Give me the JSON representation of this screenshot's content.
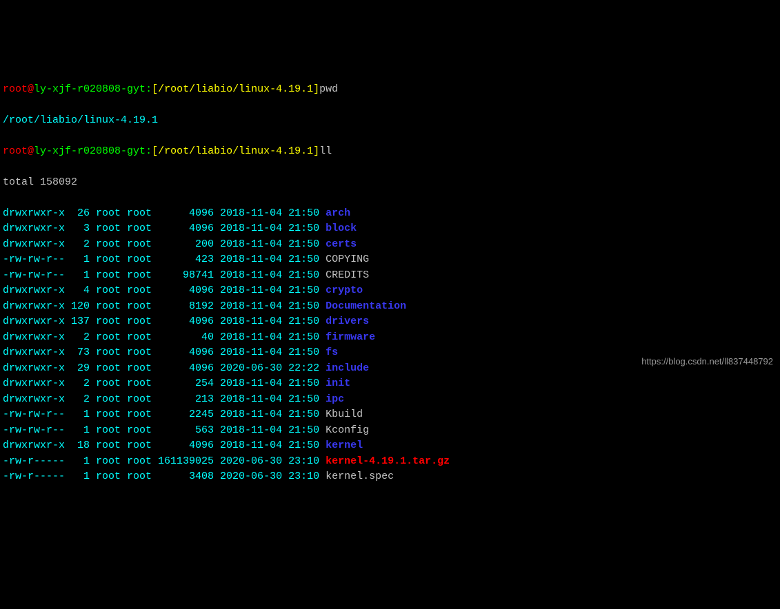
{
  "prompt1": {
    "user": "root",
    "at": "@",
    "host": "ly-xjf-r020808-gyt",
    "colon": ":",
    "lbracket": "[",
    "path": "/root/liabio/linux-4.19.1",
    "rbracket": "]",
    "command": "pwd"
  },
  "pwd_output": "/root/liabio/linux-4.19.1",
  "prompt2": {
    "user": "root",
    "at": "@",
    "host": "ly-xjf-r020808-gyt",
    "colon": ":",
    "lbracket": "[",
    "path": "/root/liabio/linux-4.19.1",
    "rbracket": "]",
    "command": "ll"
  },
  "total_line": "total 158092",
  "rows": [
    {
      "perms": "drwxrwxr-x",
      "links": "26",
      "owner": "root",
      "group": "root",
      "size": "4096",
      "date": "2018-11-04",
      "time": "21:50",
      "name": "arch",
      "type": "dir"
    },
    {
      "perms": "drwxrwxr-x",
      "links": "3",
      "owner": "root",
      "group": "root",
      "size": "4096",
      "date": "2018-11-04",
      "time": "21:50",
      "name": "block",
      "type": "dir"
    },
    {
      "perms": "drwxrwxr-x",
      "links": "2",
      "owner": "root",
      "group": "root",
      "size": "200",
      "date": "2018-11-04",
      "time": "21:50",
      "name": "certs",
      "type": "dir"
    },
    {
      "perms": "-rw-rw-r--",
      "links": "1",
      "owner": "root",
      "group": "root",
      "size": "423",
      "date": "2018-11-04",
      "time": "21:50",
      "name": "COPYING",
      "type": "file"
    },
    {
      "perms": "-rw-rw-r--",
      "links": "1",
      "owner": "root",
      "group": "root",
      "size": "98741",
      "date": "2018-11-04",
      "time": "21:50",
      "name": "CREDITS",
      "type": "file"
    },
    {
      "perms": "drwxrwxr-x",
      "links": "4",
      "owner": "root",
      "group": "root",
      "size": "4096",
      "date": "2018-11-04",
      "time": "21:50",
      "name": "crypto",
      "type": "dir"
    },
    {
      "perms": "drwxrwxr-x",
      "links": "120",
      "owner": "root",
      "group": "root",
      "size": "8192",
      "date": "2018-11-04",
      "time": "21:50",
      "name": "Documentation",
      "type": "dir"
    },
    {
      "perms": "drwxrwxr-x",
      "links": "137",
      "owner": "root",
      "group": "root",
      "size": "4096",
      "date": "2018-11-04",
      "time": "21:50",
      "name": "drivers",
      "type": "dir"
    },
    {
      "perms": "drwxrwxr-x",
      "links": "2",
      "owner": "root",
      "group": "root",
      "size": "40",
      "date": "2018-11-04",
      "time": "21:50",
      "name": "firmware",
      "type": "dir"
    },
    {
      "perms": "drwxrwxr-x",
      "links": "73",
      "owner": "root",
      "group": "root",
      "size": "4096",
      "date": "2018-11-04",
      "time": "21:50",
      "name": "fs",
      "type": "dir"
    },
    {
      "perms": "drwxrwxr-x",
      "links": "29",
      "owner": "root",
      "group": "root",
      "size": "4096",
      "date": "2020-06-30",
      "time": "22:22",
      "name": "include",
      "type": "dir"
    },
    {
      "perms": "drwxrwxr-x",
      "links": "2",
      "owner": "root",
      "group": "root",
      "size": "254",
      "date": "2018-11-04",
      "time": "21:50",
      "name": "init",
      "type": "dir"
    },
    {
      "perms": "drwxrwxr-x",
      "links": "2",
      "owner": "root",
      "group": "root",
      "size": "213",
      "date": "2018-11-04",
      "time": "21:50",
      "name": "ipc",
      "type": "dir"
    },
    {
      "perms": "-rw-rw-r--",
      "links": "1",
      "owner": "root",
      "group": "root",
      "size": "2245",
      "date": "2018-11-04",
      "time": "21:50",
      "name": "Kbuild",
      "type": "file"
    },
    {
      "perms": "-rw-rw-r--",
      "links": "1",
      "owner": "root",
      "group": "root",
      "size": "563",
      "date": "2018-11-04",
      "time": "21:50",
      "name": "Kconfig",
      "type": "file"
    },
    {
      "perms": "drwxrwxr-x",
      "links": "18",
      "owner": "root",
      "group": "root",
      "size": "4096",
      "date": "2018-11-04",
      "time": "21:50",
      "name": "kernel",
      "type": "dir"
    },
    {
      "perms": "-rw-r-----",
      "links": "1",
      "owner": "root",
      "group": "root",
      "size": "161139025",
      "date": "2020-06-30",
      "time": "23:10",
      "name": "kernel-4.19.1.tar.gz",
      "type": "archive"
    },
    {
      "perms": "-rw-r-----",
      "links": "1",
      "owner": "root",
      "group": "root",
      "size": "3408",
      "date": "2020-06-30",
      "time": "23:10",
      "name": "kernel.spec",
      "type": "file"
    }
  ],
  "watermark": "https://blog.csdn.net/ll837448792"
}
